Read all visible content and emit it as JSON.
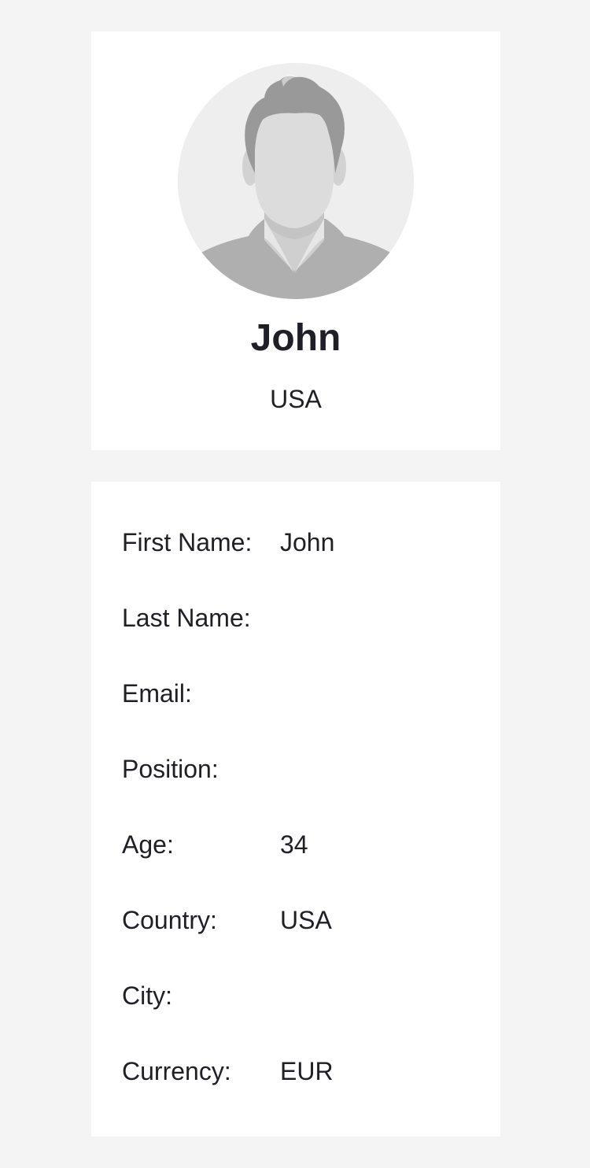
{
  "profile": {
    "avatar_icon": "user-avatar-placeholder-icon",
    "name": "John",
    "country": "USA"
  },
  "details": {
    "rows": [
      {
        "label": "First Name:",
        "value": "John"
      },
      {
        "label": "Last Name:",
        "value": ""
      },
      {
        "label": "Email:",
        "value": ""
      },
      {
        "label": "Position:",
        "value": ""
      },
      {
        "label": "Age:",
        "value": "34"
      },
      {
        "label": "Country:",
        "value": "USA"
      },
      {
        "label": "City:",
        "value": ""
      },
      {
        "label": "Currency:",
        "value": "EUR"
      }
    ]
  },
  "colors": {
    "page_background": "#f4f4f4",
    "card_background": "#ffffff",
    "text": "#1f1f28",
    "avatar_background": "#eeeeee",
    "avatar_hair": "#999999",
    "avatar_skin": "#dcdcdc",
    "avatar_shirt": "#afafaf"
  }
}
